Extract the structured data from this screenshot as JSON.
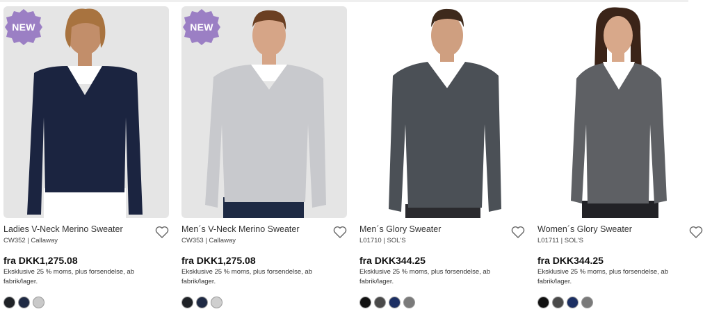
{
  "products": [
    {
      "name": "Ladies V-Neck Merino Sweater",
      "sku": "CW352 | Callaway",
      "badge": "NEW",
      "price": "fra DKK1,275.08",
      "vat_note": "Eksklusive 25 % moms, plus forsendelse, ab fabrik/lager.",
      "image_bg": "grey",
      "sweater_color": "#1b2440",
      "pants_color": "#ffffff",
      "swatches": [
        "#1f2227",
        "#1f2a44",
        "#c9c9c9"
      ]
    },
    {
      "name": "Men´s V-Neck Merino Sweater",
      "sku": "CW353 | Callaway",
      "badge": "NEW",
      "price": "fra DKK1,275.08",
      "vat_note": "Eksklusive 25 % moms, plus forsendelse, ab fabrik/lager.",
      "image_bg": "grey",
      "sweater_color": "#c8c9cd",
      "pants_color": "#1e2a44",
      "swatches": [
        "#1f2227",
        "#1f2a44",
        "#cfcfcf"
      ]
    },
    {
      "name": "Men´s Glory Sweater",
      "sku": "L01710 | SOL'S",
      "badge": "",
      "price": "fra DKK344.25",
      "vat_note": "Eksklusive 25 % moms, plus forsendelse, ab fabrik/lager.",
      "image_bg": "white",
      "sweater_color": "#4b5056",
      "pants_color": "#2a2a2e",
      "swatches": [
        "#111111",
        "#4a4a4a",
        "#1c2f63",
        "#7a7a7a"
      ]
    },
    {
      "name": "Women´s Glory Sweater",
      "sku": "L01711 | SOL'S",
      "badge": "",
      "price": "fra DKK344.25",
      "vat_note": "Eksklusive 25 % moms, plus forsendelse, ab fabrik/lager.",
      "image_bg": "white",
      "sweater_color": "#5e6064",
      "pants_color": "#222226",
      "swatches": [
        "#111111",
        "#4a4a4a",
        "#1c2f63",
        "#7a7a7a"
      ]
    }
  ],
  "colors": {
    "badge": "#9b7fc4"
  },
  "icons": {
    "favorite": "heart-outline-icon"
  }
}
